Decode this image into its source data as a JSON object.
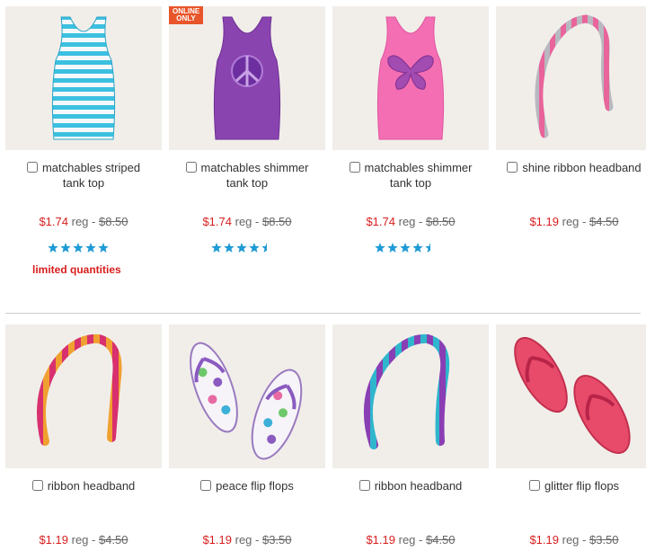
{
  "products": [
    {
      "badge": "",
      "name": "matchables striped tank top",
      "sale_price": "$1.74",
      "reg_label": "reg -",
      "reg_price": "$8.50",
      "rating": 5,
      "note": "limited quantities"
    },
    {
      "badge": "ONLINE ONLY",
      "name": "matchables shimmer tank top",
      "sale_price": "$1.74",
      "reg_label": "reg -",
      "reg_price": "$8.50",
      "rating": 4.5,
      "note": ""
    },
    {
      "badge": "",
      "name": "matchables shimmer tank top",
      "sale_price": "$1.74",
      "reg_label": "reg -",
      "reg_price": "$8.50",
      "rating": 4.5,
      "note": ""
    },
    {
      "badge": "",
      "name": "shine ribbon headband",
      "sale_price": "$1.19",
      "reg_label": "reg -",
      "reg_price": "$4.50",
      "rating": 0,
      "note": ""
    },
    {
      "badge": "",
      "name": "ribbon headband",
      "sale_price": "$1.19",
      "reg_label": "reg -",
      "reg_price": "$4.50",
      "rating": 0,
      "note": ""
    },
    {
      "badge": "",
      "name": "peace flip flops",
      "sale_price": "$1.19",
      "reg_label": "reg -",
      "reg_price": "$3.50",
      "rating": 0,
      "note": ""
    },
    {
      "badge": "",
      "name": "ribbon headband",
      "sale_price": "$1.19",
      "reg_label": "reg -",
      "reg_price": "$4.50",
      "rating": 0,
      "note": ""
    },
    {
      "badge": "",
      "name": "glitter flip flops",
      "sale_price": "$1.19",
      "reg_label": "reg -",
      "reg_price": "$3.50",
      "rating": 0,
      "note": ""
    }
  ],
  "colors": {
    "sale": "#d81e1e",
    "star": "#1e9ad6",
    "badge": "#e8552a",
    "tile": "#f1eeea"
  }
}
